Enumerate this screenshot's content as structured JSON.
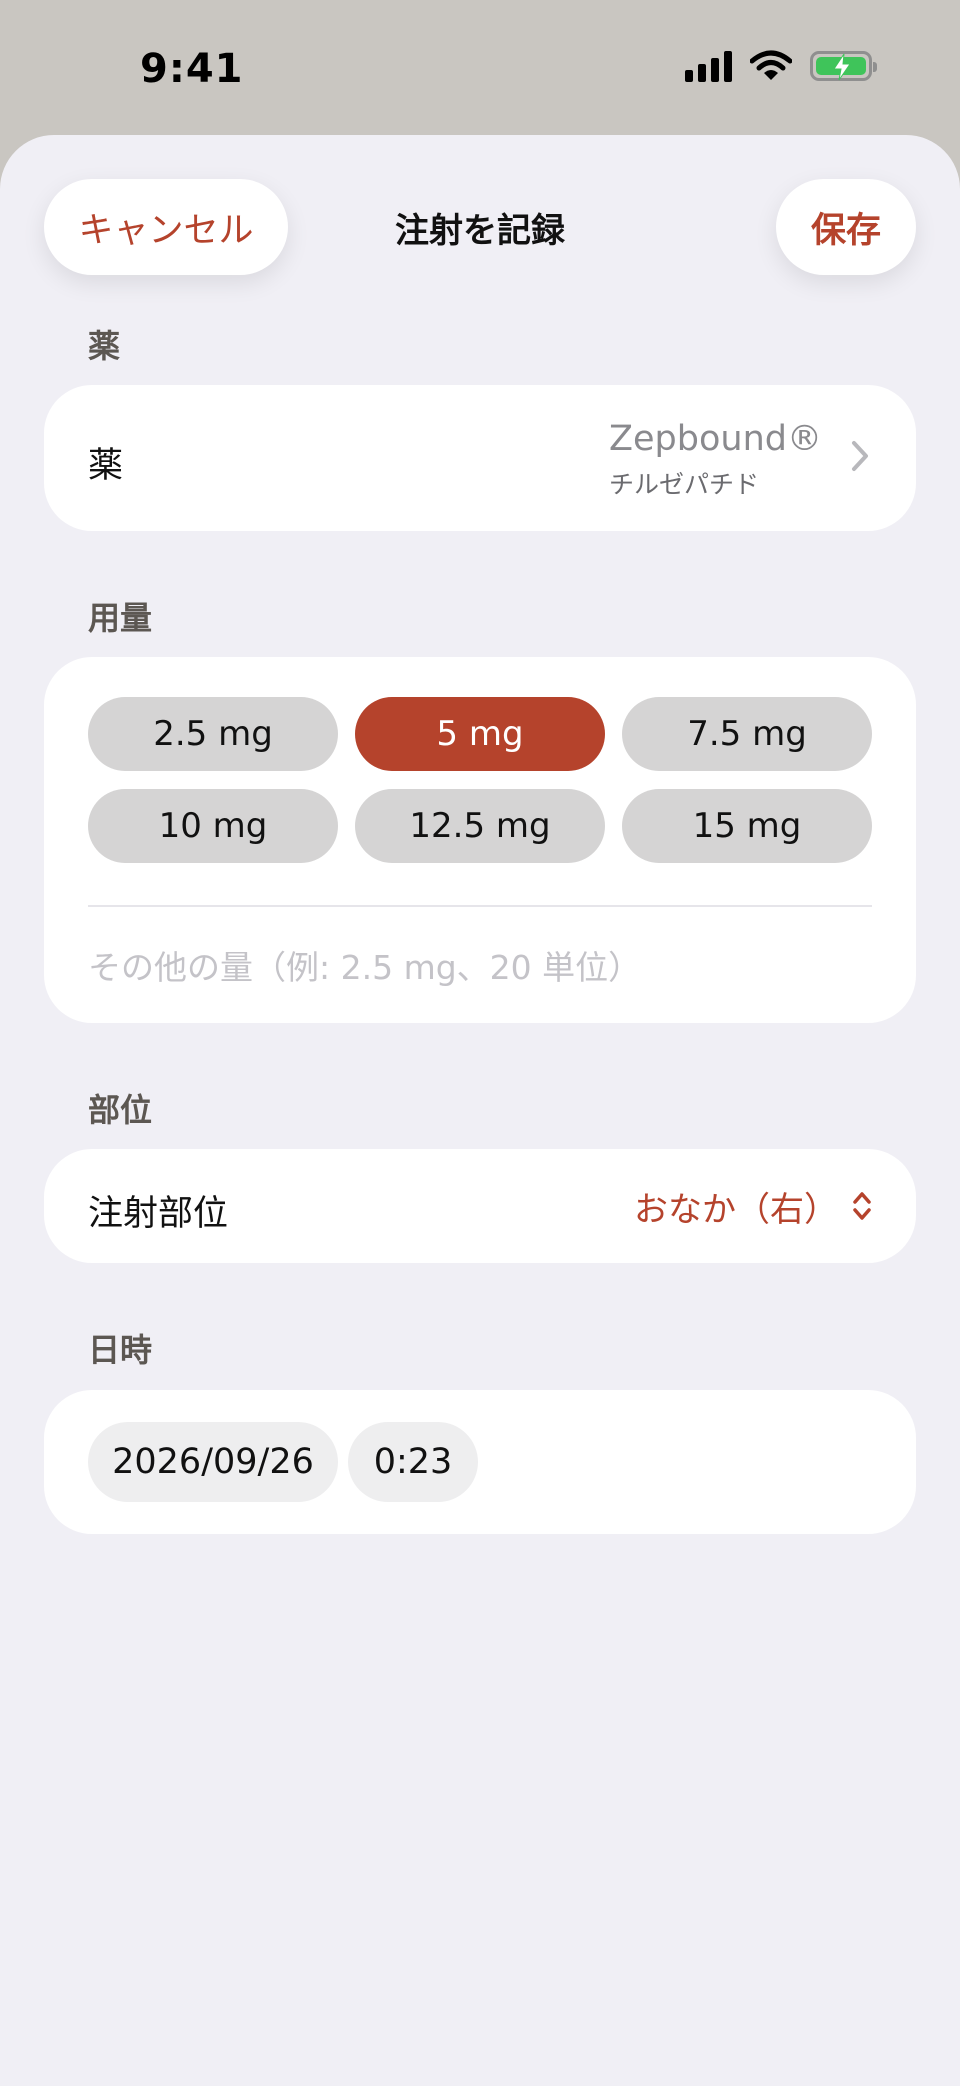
{
  "status_bar": {
    "time": "9:41",
    "icons": [
      "cellular-signal-icon",
      "wifi-icon",
      "battery-charging-icon"
    ],
    "battery_color": "#3fc45a"
  },
  "nav": {
    "cancel_label": "キャンセル",
    "title": "注射を記録",
    "save_label": "保存"
  },
  "medication_section": {
    "header": "薬",
    "row_label": "薬",
    "value_name": "Zepbound®",
    "value_generic": "チルゼパチド",
    "icon": "chevron-right-icon"
  },
  "dose_section": {
    "header": "用量",
    "options": [
      {
        "label": "2.5 mg",
        "selected": false
      },
      {
        "label": "5 mg",
        "selected": true
      },
      {
        "label": "7.5 mg",
        "selected": false
      },
      {
        "label": "10 mg",
        "selected": false
      },
      {
        "label": "12.5 mg",
        "selected": false
      },
      {
        "label": "15 mg",
        "selected": false
      }
    ],
    "other_value": "",
    "other_placeholder": "その他の量（例: 2.5 mg、20 単位）"
  },
  "site_section": {
    "header": "部位",
    "row_label": "注射部位",
    "value": "おなか（右）",
    "icon": "chevron-up-down-icon"
  },
  "datetime_section": {
    "header": "日時",
    "date": "2026/09/26",
    "time": "0:23"
  },
  "colors": {
    "accent": "#b5432c",
    "sheet_background": "#f0eff5",
    "card_background": "#ffffff",
    "chip_background": "#d5d4d4"
  }
}
